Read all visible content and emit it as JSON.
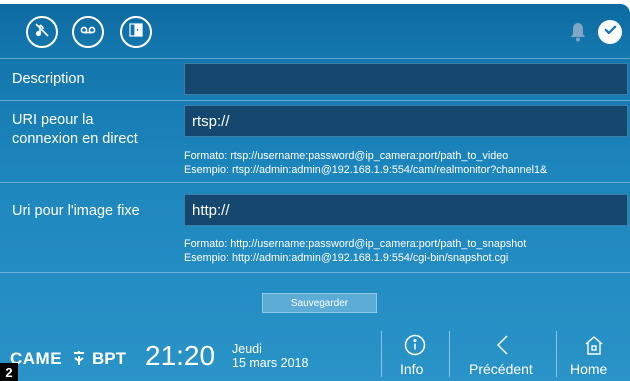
{
  "topbar": {
    "icons": [
      "ringer-mute-icon",
      "answering-machine-icon",
      "door-open-icon"
    ],
    "status_icons": [
      "bell-icon",
      "check-icon"
    ]
  },
  "form": {
    "description": {
      "label": "Description",
      "value": ""
    },
    "live_uri": {
      "label_line1": "URI peour la",
      "label_line2": "connexion en direct",
      "value": "rtsp://",
      "hint_format": "Formato: rtsp://username:password@ip_camera:port/path_to_video",
      "hint_example": "Esempio: rtsp://admin:admin@192.168.1.9:554/cam/realmonitor?channel1&"
    },
    "still_uri": {
      "label": "Uri pour l'image fixe",
      "value": "http://",
      "hint_format": "Formato: http://username:password@ip_camera:port/path_to_snapshot",
      "hint_example": "Esempio: http://admin:admin@192.168.1.9:554/cgi-bin/snapshot.cgi"
    },
    "save_label": "Sauvegarder"
  },
  "bottombar": {
    "brand_came": "CAME",
    "brand_bpt": "BPT",
    "time": "21:20",
    "day": "Jeudi",
    "date": "15 mars 2018",
    "nav": [
      {
        "label": "Info",
        "icon": "info-icon"
      },
      {
        "label": "Précédent",
        "icon": "chevron-left-icon"
      },
      {
        "label": "Home",
        "icon": "home-icon"
      }
    ]
  },
  "corner_badge": "2",
  "colors": {
    "panel_top": "#0f6fa6",
    "panel_bottom": "#2a93c8",
    "field_bg": "#15486e",
    "save_button": "#5dacd6"
  }
}
